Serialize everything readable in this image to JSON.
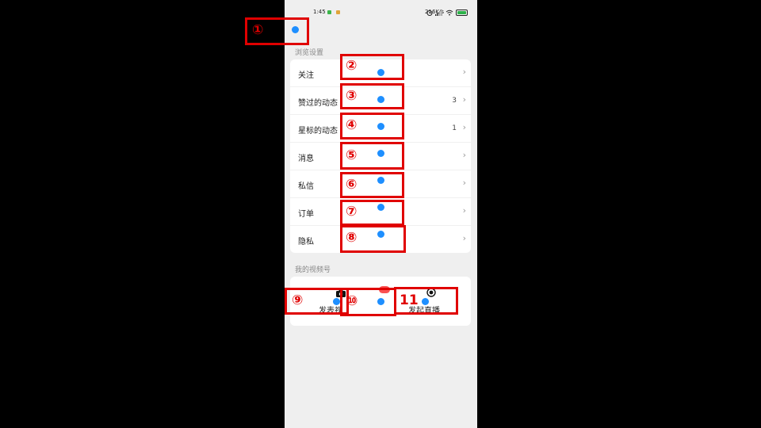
{
  "status_bar": {
    "time": "1:45",
    "network_speed": "216K/s",
    "icons": [
      "alarm-icon",
      "signal-icon",
      "wifi-icon",
      "battery-icon"
    ]
  },
  "browse_settings": {
    "title": "浏览设置",
    "rows": [
      {
        "label": "关注",
        "count": ""
      },
      {
        "label": "赞过的动态",
        "count": "3"
      },
      {
        "label": "星标的动态",
        "count": "1"
      },
      {
        "label": "消息",
        "count": ""
      },
      {
        "label": "私信",
        "count": ""
      },
      {
        "label": "订单",
        "count": ""
      },
      {
        "label": "隐私",
        "count": ""
      }
    ]
  },
  "my_channel": {
    "title": "我的视频号",
    "actions": [
      {
        "label": "发表视",
        "icon": "camera-icon"
      },
      {
        "label": "",
        "icon": "badge-icon"
      },
      {
        "label": "发起直播",
        "icon": "live-icon"
      }
    ]
  },
  "annotations": [
    "①",
    "②",
    "③",
    "④",
    "⑤",
    "⑥",
    "⑦",
    "⑧",
    "⑨",
    "⑩",
    "11"
  ],
  "colors": {
    "annotation_box": "#e00000",
    "marker_dot": "#1e8fff",
    "accent_green": "#2db34a"
  }
}
